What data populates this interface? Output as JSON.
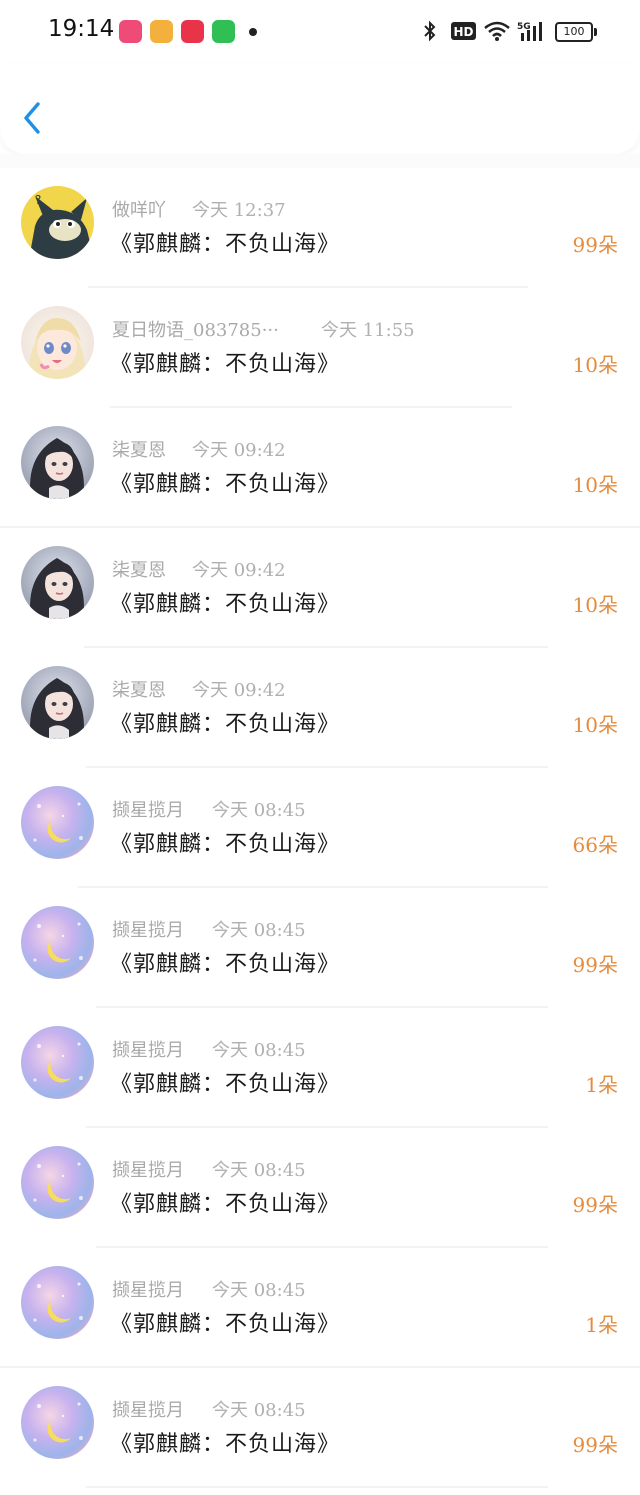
{
  "status_bar": {
    "time": "19:14",
    "battery": "100",
    "icons": [
      "bluetooth-icon",
      "hd-icon",
      "wifi-icon",
      "signal-5g-icon",
      "battery-icon"
    ]
  },
  "header": {
    "back_icon": "chevron-left-icon",
    "accent_color": "#1e90e6"
  },
  "colors": {
    "amount": "#e58b3c",
    "name": "#a9a9a9",
    "title": "#1a1a1a"
  },
  "records": [
    {
      "name": "做咩吖",
      "time": "今天 12:37",
      "title": "《郭麒麟：不负山海》",
      "amount": "99朵",
      "avatar": "cat"
    },
    {
      "name": "夏日物语_083785···",
      "time": "今天 11:55",
      "title": "《郭麒麟：不负山海》",
      "amount": "10朵",
      "avatar": "anime-girl"
    },
    {
      "name": "柒夏恩",
      "time": "今天 09:42",
      "title": "《郭麒麟：不负山海》",
      "amount": "10朵",
      "avatar": "dark-girl"
    },
    {
      "name": "柒夏恩",
      "time": "今天 09:42",
      "title": "《郭麒麟：不负山海》",
      "amount": "10朵",
      "avatar": "dark-girl"
    },
    {
      "name": "柒夏恩",
      "time": "今天 09:42",
      "title": "《郭麒麟：不负山海》",
      "amount": "10朵",
      "avatar": "dark-girl"
    },
    {
      "name": "撷星揽月",
      "time": "今天 08:45",
      "title": "《郭麒麟：不负山海》",
      "amount": "66朵",
      "avatar": "moon"
    },
    {
      "name": "撷星揽月",
      "time": "今天 08:45",
      "title": "《郭麒麟：不负山海》",
      "amount": "99朵",
      "avatar": "moon"
    },
    {
      "name": "撷星揽月",
      "time": "今天 08:45",
      "title": "《郭麒麟：不负山海》",
      "amount": "1朵",
      "avatar": "moon"
    },
    {
      "name": "撷星揽月",
      "time": "今天 08:45",
      "title": "《郭麒麟：不负山海》",
      "amount": "99朵",
      "avatar": "moon"
    },
    {
      "name": "撷星揽月",
      "time": "今天 08:45",
      "title": "《郭麒麟：不负山海》",
      "amount": "1朵",
      "avatar": "moon"
    },
    {
      "name": "撷星揽月",
      "time": "今天 08:45",
      "title": "《郭麒麟：不负山海》",
      "amount": "99朵",
      "avatar": "moon"
    }
  ]
}
